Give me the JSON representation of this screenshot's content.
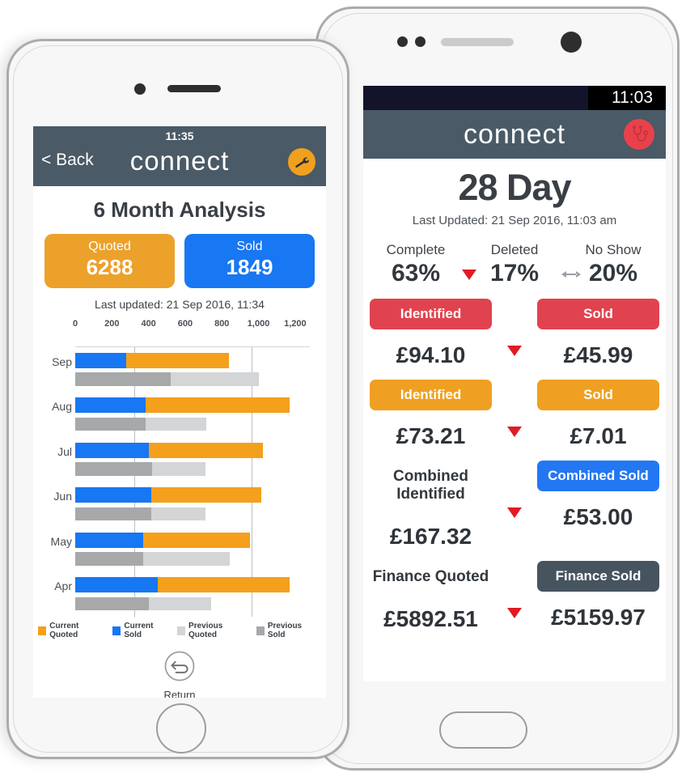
{
  "right_phone": {
    "status_bar": {
      "time": "11:03"
    },
    "navbar": {
      "logo": "connect",
      "avatar_icon": "stethoscope-icon"
    },
    "title": "28 Day",
    "last_updated": "Last Updated: 21 Sep 2016, 11:03 am",
    "percentages": [
      {
        "label": "Complete",
        "value": "63%",
        "indicator": "none"
      },
      {
        "label": "Deleted",
        "value": "17%",
        "indicator": "down-triangle-icon"
      },
      {
        "label": "No Show",
        "value": "20%",
        "indicator": "left-right-arrow-icon"
      }
    ],
    "rows": [
      {
        "left": {
          "label": "Identified",
          "value": "£94.10",
          "style": "red",
          "pill": true
        },
        "right": {
          "label": "Sold",
          "value": "£45.99",
          "style": "red",
          "pill": true
        },
        "indicator": "down-triangle-icon"
      },
      {
        "left": {
          "label": "Identified",
          "value": "£73.21",
          "style": "orange",
          "pill": true
        },
        "right": {
          "label": "Sold",
          "value": "£7.01",
          "style": "orange",
          "pill": true
        },
        "indicator": "down-triangle-icon"
      },
      {
        "left": {
          "label": "Combined Identified",
          "value": "£167.32",
          "style": "plain",
          "pill": false
        },
        "right": {
          "label": "Combined Sold",
          "value": "£53.00",
          "style": "blue",
          "pill": true
        },
        "indicator": "down-triangle-icon"
      },
      {
        "left": {
          "label": "Finance Quoted",
          "value": "£5892.51",
          "style": "plain",
          "pill": false
        },
        "right": {
          "label": "Finance Sold",
          "value": "£5159.97",
          "style": "dark",
          "pill": true
        },
        "indicator": "down-triangle-icon"
      }
    ]
  },
  "left_phone": {
    "navbar": {
      "time": "11:35",
      "back_label": "< Back",
      "logo": "connect",
      "settings_icon": "wrench-icon"
    },
    "title": "6 Month Analysis",
    "kpis": [
      {
        "label": "Quoted",
        "value": "6288",
        "color": "#eca12a"
      },
      {
        "label": "Sold",
        "value": "1849",
        "color": "#1877f2"
      }
    ],
    "last_updated": "Last updated: 21 Sep 2016, 11:34",
    "return_button": {
      "label": "Return",
      "icon": "return-arrow-icon"
    }
  },
  "colors": {
    "current_quoted": "#f4a01c",
    "current_sold": "#1877f2",
    "previous_quoted": "#d3d5d7",
    "previous_sold": "#a6a8aa",
    "navbar": "#4a5a66",
    "red": "#e0434f"
  },
  "chart_data": {
    "type": "bar",
    "orientation": "horizontal",
    "stacked": true,
    "title": "6 Month Analysis",
    "xlabel": "",
    "ylabel": "",
    "xlim": [
      0,
      1280
    ],
    "grid": true,
    "gridlines": [
      320,
      960
    ],
    "legend_position": "bottom",
    "categories": [
      "Sep",
      "Aug",
      "Jul",
      "Jun",
      "May",
      "Apr"
    ],
    "tick_labels": [
      "0",
      "200",
      "400",
      "600",
      "800",
      "1,000",
      "1,200"
    ],
    "ticks": [
      0,
      200,
      400,
      600,
      800,
      1000,
      1200
    ],
    "series": [
      {
        "name": "Current Sold",
        "color": "#1877f2",
        "row": "current",
        "values": [
          280,
          385,
          400,
          415,
          370,
          450
        ]
      },
      {
        "name": "Current Quoted",
        "color": "#f4a01c",
        "row": "current",
        "values": [
          560,
          785,
          625,
          600,
          585,
          720
        ]
      },
      {
        "name": "Previous Sold",
        "color": "#a6a8aa",
        "row": "previous",
        "values": [
          520,
          385,
          420,
          415,
          370,
          400
        ]
      },
      {
        "name": "Previous Quoted",
        "color": "#d3d5d7",
        "row": "previous",
        "values": [
          480,
          330,
          290,
          295,
          475,
          340
        ]
      }
    ],
    "totals": {
      "current": [
        840,
        1170,
        1025,
        1015,
        955,
        1170
      ],
      "previous": [
        1000,
        715,
        710,
        710,
        845,
        740
      ]
    }
  }
}
